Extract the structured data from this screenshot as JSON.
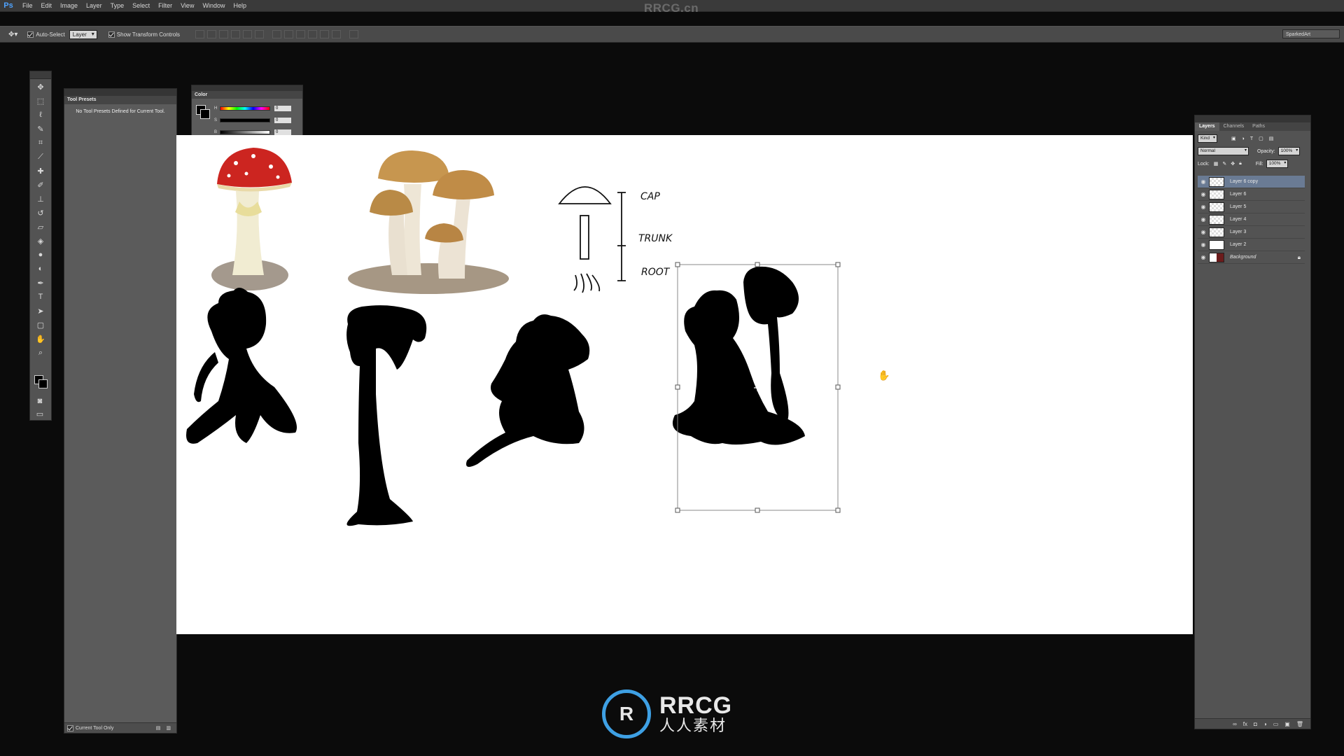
{
  "watermark": {
    "top": "RRCG.cn",
    "brand_title": "RRCG",
    "brand_sub": "人人素材"
  },
  "menubar": {
    "logo": "Ps",
    "items": [
      "File",
      "Edit",
      "Image",
      "Layer",
      "Type",
      "Select",
      "Filter",
      "View",
      "Window",
      "Help"
    ]
  },
  "options": {
    "auto_select": "Auto-Select",
    "auto_select_target": "Layer",
    "show_transform": "Show Transform Controls",
    "workspace": "SparkedArt"
  },
  "tool_presets": {
    "title": "Tool Presets",
    "message": "No Tool Presets Defined for Current Tool.",
    "current_tool_only": "Current Tool Only"
  },
  "color_panel": {
    "title": "Color",
    "channels": [
      {
        "label": "H",
        "value": "0"
      },
      {
        "label": "S",
        "value": "0"
      },
      {
        "label": "B",
        "value": "0"
      }
    ]
  },
  "canvas": {
    "sketch_labels": {
      "cap": "CAP",
      "trunk": "TRUNK",
      "root": "ROOT"
    }
  },
  "layers_panel": {
    "tabs": [
      "Layers",
      "Channels",
      "Paths"
    ],
    "kind": "Kind",
    "blend_mode": "Normal",
    "opacity_label": "Opacity:",
    "opacity_value": "100%",
    "lock_label": "Lock:",
    "fill_label": "Fill:",
    "fill_value": "100%",
    "layers": [
      {
        "name": "Layer 6 copy",
        "selected": true
      },
      {
        "name": "Layer 6"
      },
      {
        "name": "Layer 5"
      },
      {
        "name": "Layer 4"
      },
      {
        "name": "Layer 3"
      },
      {
        "name": "Layer 2"
      },
      {
        "name": "Background"
      }
    ]
  }
}
